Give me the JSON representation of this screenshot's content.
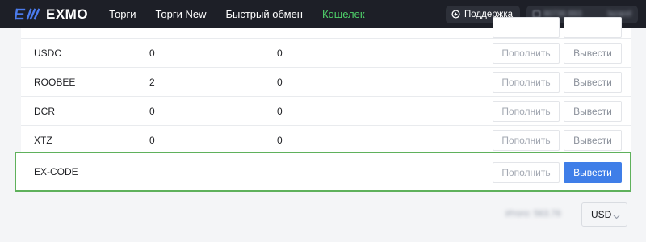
{
  "app": {
    "logo_text": "EXMO"
  },
  "nav": {
    "links": [
      {
        "label": "Торги",
        "active": false
      },
      {
        "label": "Торги New",
        "active": false
      },
      {
        "label": "Быстрый обмен",
        "active": false
      },
      {
        "label": "Кошелек",
        "active": true
      }
    ],
    "support_label": "Поддержка",
    "account_id": "90736 893",
    "account_name": "lazarel"
  },
  "wallet": {
    "rows": [
      {
        "currency": "",
        "balance": "",
        "reserved": "",
        "deposit_label": "",
        "withdraw_label": ""
      },
      {
        "currency": "USDC",
        "balance": "0",
        "reserved": "0",
        "deposit_label": "Пополнить",
        "withdraw_label": "Вывести"
      },
      {
        "currency": "ROOBEE",
        "balance": "2",
        "reserved": "0",
        "deposit_label": "Пополнить",
        "withdraw_label": "Вывести"
      },
      {
        "currency": "DCR",
        "balance": "0",
        "reserved": "0",
        "deposit_label": "Пополнить",
        "withdraw_label": "Вывести"
      },
      {
        "currency": "XTZ",
        "balance": "0",
        "reserved": "0",
        "deposit_label": "Пополнить",
        "withdraw_label": "Вывести"
      }
    ],
    "highlighted_row": {
      "currency": "EX-CODE",
      "deposit_label": "Пополнить",
      "withdraw_label": "Вывести"
    }
  },
  "footer": {
    "total_text": "Итого: 563.76",
    "currency": "USD"
  },
  "colors": {
    "navbar_bg": "#1d1f27",
    "brand_blue": "#4b7bec",
    "active_nav": "#4fd16a",
    "primary_button": "#3f7ee8",
    "highlight_border": "#5fb15c"
  },
  "icons": {
    "logo": "exmo-logo-icon",
    "support": "chat-icon",
    "currency_select": "chevron-down-icon"
  }
}
